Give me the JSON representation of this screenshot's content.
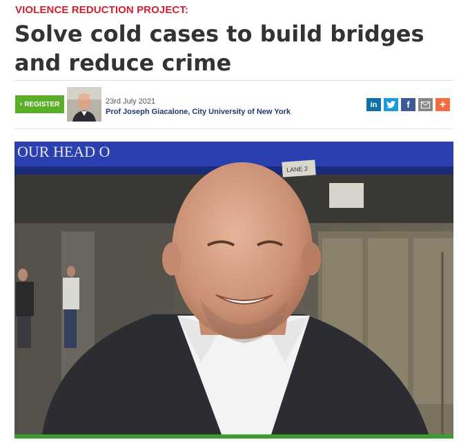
{
  "article": {
    "kicker": "VIOLENCE REDUCTION PROJECT:",
    "title": "Solve cold cases to build bridges and reduce crime",
    "register_label": "REGISTER",
    "date": "23rd July 2021",
    "author": "Prof Joseph Giacalone, City University of New York"
  },
  "share": {
    "linkedin": "in",
    "facebook": "f",
    "more": "+"
  },
  "hero_image": {
    "sign_text": "OUR HEAD O",
    "lane_sign": "LANE 2"
  },
  "colors": {
    "kicker": "#d11f2f",
    "register": "#5aae2a",
    "author": "#1e3a6e",
    "accent_bar": "#3c9e2e"
  },
  "icons": [
    "chevron-right-icon",
    "linkedin-icon",
    "twitter-icon",
    "facebook-icon",
    "email-icon",
    "plus-icon"
  ]
}
